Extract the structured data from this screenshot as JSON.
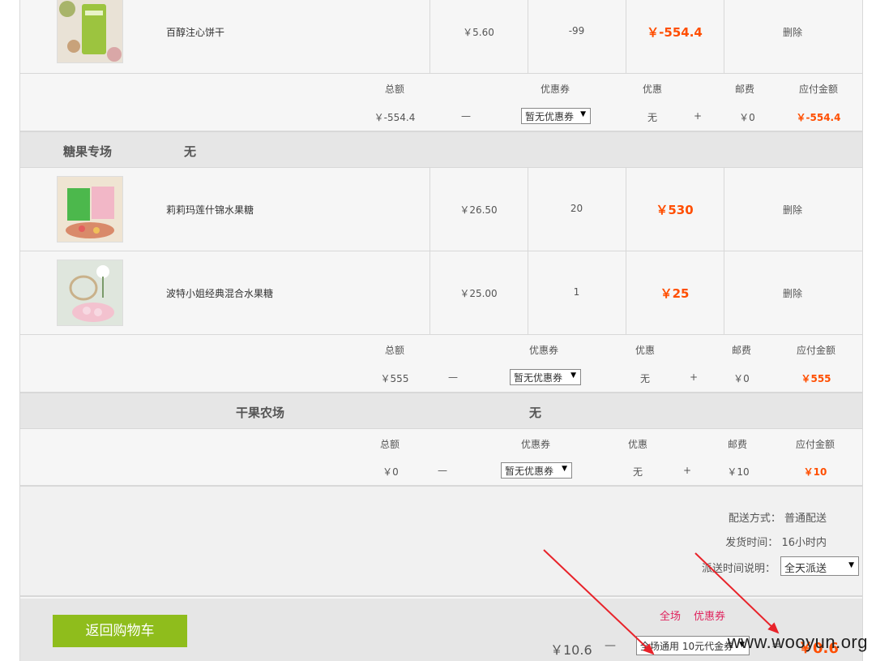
{
  "accent_color": "#ff4e00",
  "button_color": "#8fbd1c",
  "link_color": "#e0245e",
  "shops": [
    {
      "name": "",
      "discount_label": "",
      "products": [
        {
          "name": "百醇注心饼干",
          "price": "￥5.60",
          "qty": "-99",
          "subtotal": "￥-554.4",
          "action": "删除",
          "image_icon": "cookie-box-image"
        }
      ],
      "summary": {
        "labels": {
          "total": "总额",
          "coupon": "优惠券",
          "discount": "优惠",
          "shipping": "邮费",
          "payable": "应付金额"
        },
        "total": "￥-554.4",
        "dash": "—",
        "coupon_value": "暂无优惠券",
        "discount": "无",
        "plus": "+",
        "shipping": "￥0",
        "payable": "￥-554.4"
      }
    },
    {
      "name": "糖果专场",
      "discount_label": "无",
      "products": [
        {
          "name": "莉莉玛莲什锦水果糖",
          "price": "￥26.50",
          "qty": "20",
          "subtotal": "￥530",
          "action": "删除",
          "image_icon": "candy-box-image"
        },
        {
          "name": "波特小姐经典混合水果糖",
          "price": "￥25.00",
          "qty": "1",
          "subtotal": "￥25",
          "action": "删除",
          "image_icon": "candy-jar-image"
        }
      ],
      "summary": {
        "labels": {
          "total": "总额",
          "coupon": "优惠券",
          "discount": "优惠",
          "shipping": "邮费",
          "payable": "应付金额"
        },
        "total": "￥555",
        "dash": "—",
        "coupon_value": "暂无优惠券",
        "discount": "无",
        "plus": "+",
        "shipping": "￥0",
        "payable": "￥555"
      }
    },
    {
      "name": "干果农场",
      "discount_label": "无",
      "products": [],
      "summary": {
        "labels": {
          "total": "总额",
          "coupon": "优惠券",
          "discount": "优惠",
          "shipping": "邮费",
          "payable": "应付金额"
        },
        "total": "￥0",
        "dash": "—",
        "coupon_value": "暂无优惠券",
        "discount": "无",
        "plus": "+",
        "shipping": "￥10",
        "payable": "￥10"
      }
    }
  ],
  "delivery": {
    "method_label": "配送方式：",
    "method_value": "普通配送",
    "ship_time_label": "发货时间：",
    "ship_time_value": "16小时内",
    "dispatch_label": "派送时间说明：",
    "dispatch_value": "全天派送"
  },
  "footer": {
    "back_button": "返回购物车",
    "tab_all": "全场",
    "tab_coupon": "优惠券",
    "total": "￥10.6",
    "dash": "—",
    "coupon_select": "全场通用 10元代金券",
    "equals": "=",
    "final": "￥0.6"
  },
  "watermark": "www.wooyun.org"
}
